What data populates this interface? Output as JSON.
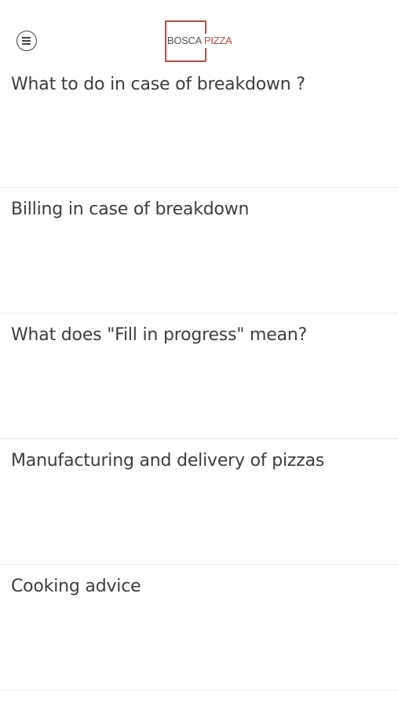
{
  "header": {
    "menu_icon": "hamburger-menu-icon",
    "logo": {
      "word1": "BOSCA",
      "word2": "PIZZA",
      "accent_color": "#c9473d"
    }
  },
  "faq": [
    {
      "title": "What to do in case of breakdown ?"
    },
    {
      "title": "Billing in case of breakdown"
    },
    {
      "title": "What does \"Fill in progress\" mean?"
    },
    {
      "title": "Manufacturing and delivery of pizzas"
    },
    {
      "title": "Cooking advice"
    }
  ]
}
